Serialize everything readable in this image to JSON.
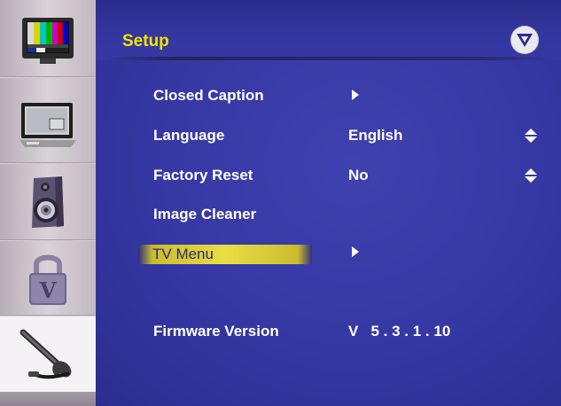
{
  "title": "Setup",
  "brand_logo": "V",
  "colors": {
    "panel_blue": "#3538a3",
    "title_yellow": "#f2e400",
    "highlight_yellow": "#ebdd45",
    "text_white": "#ffffff"
  },
  "sidebar": {
    "items": [
      {
        "icon": "tv-color-bars-icon",
        "active": false
      },
      {
        "icon": "monitor-icon",
        "active": false
      },
      {
        "icon": "speaker-icon",
        "active": false
      },
      {
        "icon": "padlock-icon",
        "active": false
      },
      {
        "icon": "wrench-icon",
        "active": true
      }
    ]
  },
  "menu": {
    "items": [
      {
        "label": "Closed Caption",
        "value": "",
        "control": "arrow-right-icon",
        "selected": false
      },
      {
        "label": "Language",
        "value": "English",
        "control": "up-down-icon",
        "selected": false
      },
      {
        "label": "Factory Reset",
        "value": "No",
        "control": "up-down-icon",
        "selected": false
      },
      {
        "label": "Image Cleaner",
        "value": "",
        "control": "",
        "selected": false
      },
      {
        "label": "TV Menu",
        "value": "",
        "control": "arrow-right-icon",
        "selected": true
      }
    ],
    "firmware": {
      "label": "Firmware Version",
      "value": "V   5 . 3 . 1 . 10"
    }
  }
}
